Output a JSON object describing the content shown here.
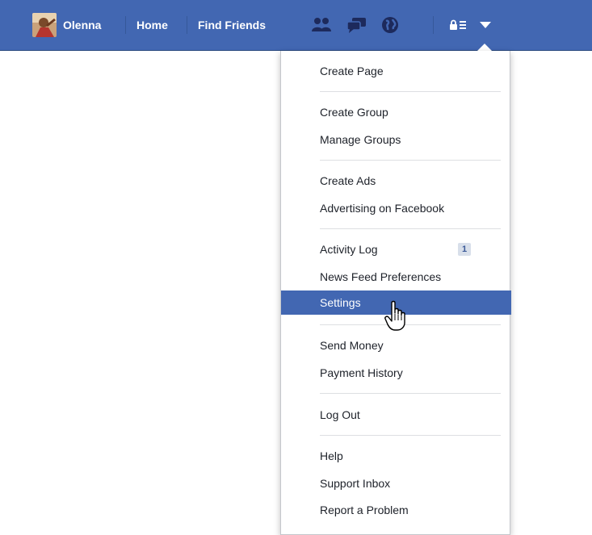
{
  "topbar": {
    "user_name": "Olenna",
    "home_label": "Home",
    "find_friends_label": "Find Friends",
    "icons": [
      "friend-requests-icon",
      "messages-icon",
      "notifications-globe-icon",
      "privacy-shortcuts-icon",
      "account-menu-chevron-icon"
    ],
    "brand_color": "#4267b2"
  },
  "menu": {
    "items": [
      {
        "label": "Create Page"
      },
      {
        "label": "Create Group"
      },
      {
        "label": "Manage Groups"
      },
      {
        "label": "Create Ads"
      },
      {
        "label": "Advertising on Facebook"
      },
      {
        "label": "Activity Log",
        "badge": "1"
      },
      {
        "label": "News Feed Preferences"
      },
      {
        "label": "Settings",
        "active": true
      },
      {
        "label": "Send Money"
      },
      {
        "label": "Payment History"
      },
      {
        "label": "Log Out"
      },
      {
        "label": "Help"
      },
      {
        "label": "Support Inbox"
      },
      {
        "label": "Report a Problem"
      }
    ],
    "active_color": "#4267b2"
  }
}
